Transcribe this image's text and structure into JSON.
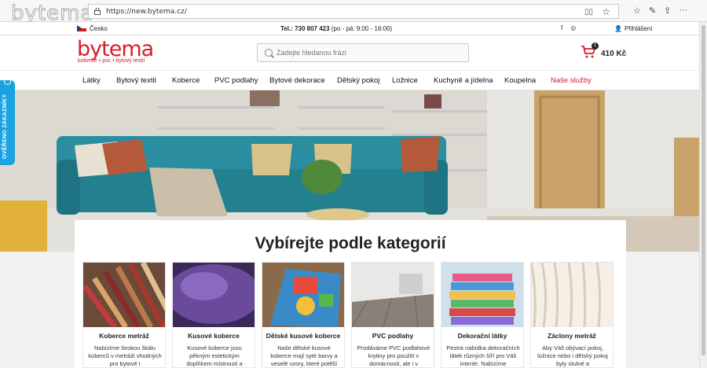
{
  "browser": {
    "watermark": "bytema",
    "url": "https://new.bytema.cz/"
  },
  "topbar": {
    "country": "Česko",
    "tel_label": "Tel.: 730 807 423",
    "hours": "(po - pá: 9:00 - 16:00)",
    "login": "Přihlášení"
  },
  "header": {
    "logo": "bytema",
    "slogan": "koberce • pvc • bytový textil",
    "search_placeholder": "Zadejte hledanou frázi",
    "cart_count": "1",
    "cart_price": "410 Kč"
  },
  "nav": [
    "Látky",
    "Bytový textil",
    "Koberce",
    "PVC podlahy",
    "Bytové dekorace",
    "Dětský pokoj",
    "Ložnice",
    "Kuchyně a jídelna",
    "Koupelna",
    "Naše služby"
  ],
  "side_badge": "OVĚŘENO ZÁKAZNÍKY",
  "categories": {
    "title": "Vybírejte podle kategorií",
    "items": [
      {
        "title": "Koberce metráž",
        "desc": "Nabízíme širokou škálu koberců v metráži vhodných pro bytové i"
      },
      {
        "title": "Kusové koberce",
        "desc": "Kusové koberce jsou pěkným estetickým doplňkem místností a"
      },
      {
        "title": "Dětské kusové koberce",
        "desc": "Naše dětské kusové koberce mají syté barvy a veselé vzory, které potěší"
      },
      {
        "title": "PVC podlahy",
        "desc": "Prodáváme PVC podlahové krytiny pro použití v domácnosti, ale i v"
      },
      {
        "title": "Dekorační látky",
        "desc": "Pestrá nabídka dekoračních látek různých šíří pro Váš interiér. Nabízíme"
      },
      {
        "title": "Záclony metráž",
        "desc": "Aby Váš obývací pokoj, ložnice nebo i dětský pokoj byly útulné a"
      }
    ]
  },
  "colors": {
    "brand": "#d51e2a",
    "badge": "#1ba3e0",
    "sofa": "#2a8ea0"
  }
}
